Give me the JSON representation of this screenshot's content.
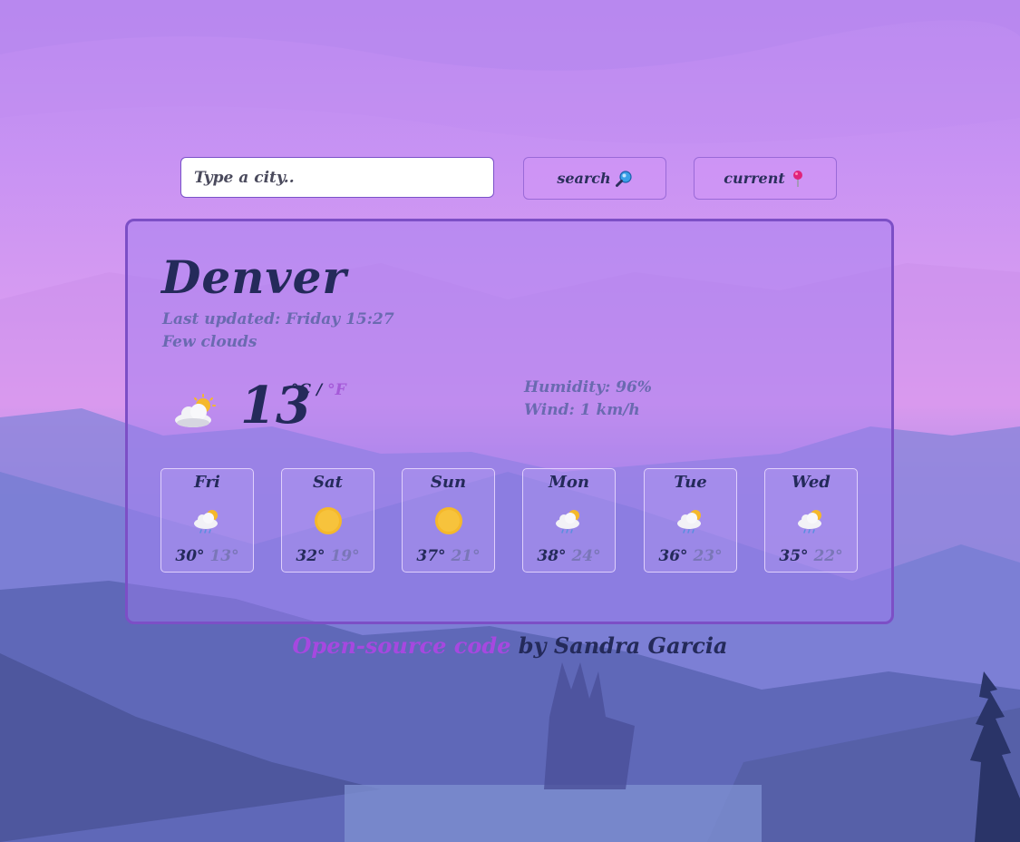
{
  "search": {
    "placeholder": "Type a city..",
    "search_label": "search",
    "search_icon": "magnifier-icon",
    "current_label": "current",
    "current_icon": "pushpin-icon"
  },
  "weather": {
    "city": "Denver",
    "last_updated": "Last updated: Friday 15:27",
    "description": "Few clouds",
    "icon": "partly-cloudy-icon",
    "temperature": "13",
    "unit_c": "°C",
    "unit_sep": " / ",
    "unit_f": "°F",
    "humidity": "Humidity: 96%",
    "wind": "Wind: 1 km/h"
  },
  "forecast": [
    {
      "day": "Fri",
      "icon": "rain-cloud-sun-icon",
      "max": "30°",
      "min": "13°"
    },
    {
      "day": "Sat",
      "icon": "sun-icon",
      "max": "32°",
      "min": "19°"
    },
    {
      "day": "Sun",
      "icon": "sun-icon",
      "max": "37°",
      "min": "21°"
    },
    {
      "day": "Mon",
      "icon": "rain-cloud-sun-icon",
      "max": "38°",
      "min": "24°"
    },
    {
      "day": "Tue",
      "icon": "rain-cloud-sun-icon",
      "max": "36°",
      "min": "23°"
    },
    {
      "day": "Wed",
      "icon": "rain-cloud-sun-icon",
      "max": "35°",
      "min": "22°"
    }
  ],
  "footer": {
    "link_text": "Open-source code",
    "rest_text": " by Sandra Garcia"
  },
  "colors": {
    "accent": "#a648e0",
    "text_dark": "#242a5a",
    "text_muted": "#6a6ab0",
    "card_border": "#7c4fc6"
  }
}
